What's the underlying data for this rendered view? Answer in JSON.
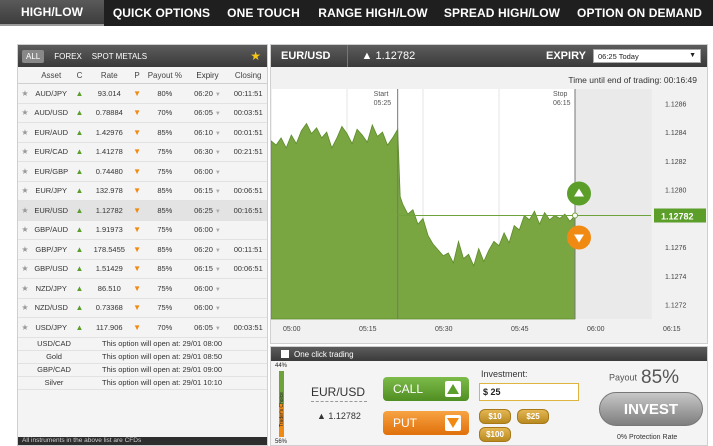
{
  "nav": [
    {
      "label": "HIGH/LOW",
      "active": true
    },
    {
      "label": "QUICK OPTIONS"
    },
    {
      "label": "ONE TOUCH"
    },
    {
      "label": "RANGE HIGH/LOW"
    },
    {
      "label": "SPREAD HIGH/LOW"
    },
    {
      "label": "OPTION ON DEMAND"
    }
  ],
  "left": {
    "filters": [
      "ALL",
      "FOREX",
      "SPOT METALS"
    ],
    "columns": {
      "asset": "Asset",
      "c": "C",
      "rate": "Rate",
      "p": "P",
      "payout": "Payout %",
      "expiry": "Expiry",
      "closing": "Closing"
    },
    "rows": [
      {
        "asset": "AUD/JPY",
        "dir": "up",
        "rate": "93.014",
        "p": "down",
        "payout": "80%",
        "expiry": "06:20",
        "closing": "00:11:51"
      },
      {
        "asset": "AUD/USD",
        "dir": "up",
        "rate": "0.78884",
        "p": "down",
        "payout": "70%",
        "expiry": "06:05",
        "closing": "00:03:51"
      },
      {
        "asset": "EUR/AUD",
        "dir": "up",
        "rate": "1.42976",
        "p": "down",
        "payout": "85%",
        "expiry": "06:10",
        "closing": "00:01:51"
      },
      {
        "asset": "EUR/CAD",
        "dir": "up",
        "rate": "1.41278",
        "p": "down",
        "payout": "75%",
        "expiry": "06:30",
        "closing": "00:21:51"
      },
      {
        "asset": "EUR/GBP",
        "dir": "up",
        "rate": "0.74480",
        "p": "down",
        "payout": "75%",
        "expiry": "06:00",
        "closing": ""
      },
      {
        "asset": "EUR/JPY",
        "dir": "up",
        "rate": "132.978",
        "p": "down",
        "payout": "85%",
        "expiry": "06:15",
        "closing": "00:06:51"
      },
      {
        "asset": "EUR/USD",
        "dir": "up",
        "rate": "1.12782",
        "p": "down",
        "payout": "85%",
        "expiry": "06:25",
        "closing": "00:16:51"
      },
      {
        "asset": "GBP/AUD",
        "dir": "up",
        "rate": "1.91973",
        "p": "down",
        "payout": "75%",
        "expiry": "06:00",
        "closing": ""
      },
      {
        "asset": "GBP/JPY",
        "dir": "up",
        "rate": "178.5455",
        "p": "down",
        "payout": "85%",
        "expiry": "06:20",
        "closing": "00:11:51"
      },
      {
        "asset": "GBP/USD",
        "dir": "up",
        "rate": "1.51429",
        "p": "down",
        "payout": "85%",
        "expiry": "06:15",
        "closing": "00:06:51"
      },
      {
        "asset": "NZD/JPY",
        "dir": "up",
        "rate": "86.510",
        "p": "down",
        "payout": "75%",
        "expiry": "06:00",
        "closing": ""
      },
      {
        "asset": "NZD/USD",
        "dir": "up",
        "rate": "0.73368",
        "p": "down",
        "payout": "75%",
        "expiry": "06:00",
        "closing": ""
      },
      {
        "asset": "USD/JPY",
        "dir": "up",
        "rate": "117.906",
        "p": "down",
        "payout": "70%",
        "expiry": "06:05",
        "closing": "00:03:51"
      }
    ],
    "upcoming": [
      {
        "asset": "USD/CAD",
        "text": "This option will open at: 29/01 08:00"
      },
      {
        "asset": "Gold",
        "text": "This option will open at: 29/01 08:50"
      },
      {
        "asset": "GBP/CAD",
        "text": "This option will open at: 29/01 09:00"
      },
      {
        "asset": "Silver",
        "text": "This option will open at: 29/01 10:10"
      }
    ],
    "footer": "All instruments in the above list are CFDs"
  },
  "chart": {
    "pair": "EUR/USD",
    "price": "▲ 1.12782",
    "expiry_label": "EXPIRY",
    "expiry_value": "06:25 Today",
    "time_until": "Time until end of trading: 00:16:49",
    "start_label": "Start",
    "start_time": "05:25",
    "stop_label": "Stop",
    "stop_time": "06:15",
    "current_label": "1.12782"
  },
  "chart_data": {
    "type": "area",
    "x_ticks": [
      "05:00",
      "05:15",
      "05:30",
      "05:45",
      "06:00",
      "06:15"
    ],
    "y_ticks": [
      "1.1286",
      "1.1284",
      "1.1282",
      "1.1280",
      "1.1278",
      "1.1276",
      "1.1274",
      "1.1272"
    ],
    "ylim": [
      1.1271,
      1.1287
    ],
    "xlim_minutes": [
      0,
      75
    ],
    "current_value": 1.12782,
    "start_minute": 25,
    "stop_minute": 75,
    "x_minutes": [
      0,
      1,
      2,
      3,
      4,
      5,
      6,
      7,
      8,
      9,
      10,
      11,
      12,
      13,
      14,
      15,
      16,
      17,
      18,
      19,
      20,
      21,
      22,
      23,
      24,
      25,
      25.5,
      26,
      27,
      28,
      29,
      30,
      31,
      32,
      33,
      34,
      35,
      36,
      37,
      38,
      39,
      40,
      41,
      42,
      43,
      44,
      45,
      46,
      47,
      48,
      49,
      50,
      51,
      52,
      53,
      54,
      55,
      56,
      57,
      58,
      59,
      60
    ],
    "values": [
      1.12834,
      1.12831,
      1.12836,
      1.12829,
      1.12838,
      1.12832,
      1.12841,
      1.12846,
      1.12839,
      1.12843,
      1.12836,
      1.1284,
      1.12829,
      1.12836,
      1.12844,
      1.12839,
      1.12832,
      1.12842,
      1.12838,
      1.12833,
      1.12845,
      1.12837,
      1.1284,
      1.12831,
      1.12836,
      1.12842,
      1.12795,
      1.1279,
      1.12783,
      1.12786,
      1.12776,
      1.1278,
      1.12768,
      1.12762,
      1.12758,
      1.12754,
      1.12756,
      1.12749,
      1.12764,
      1.12752,
      1.12755,
      1.12747,
      1.12759,
      1.1275,
      1.12758,
      1.12764,
      1.12761,
      1.1277,
      1.12763,
      1.12775,
      1.12772,
      1.12782,
      1.12779,
      1.12785,
      1.12776,
      1.12784,
      1.12779,
      1.12782,
      1.1278,
      1.12783,
      1.12778,
      1.12782
    ]
  },
  "bottom": {
    "one_click": "One click trading",
    "tc_top": "44%",
    "tc_bottom": "56%",
    "tc_label": "Trader's Choice",
    "pair": "EUR/USD",
    "price": "▲ 1.12782",
    "call": "CALL",
    "put": "PUT",
    "investment_label": "Investment:",
    "investment_value": "$ 25",
    "chips": [
      "$10",
      "$25",
      "$100"
    ],
    "payout_label": "Payout",
    "payout_value": "85%",
    "invest": "INVEST",
    "protection": "0% Protection Rate"
  },
  "colors": {
    "green": "#6ea23a",
    "orange": "#f08a13",
    "header": "#3a3a3a"
  }
}
